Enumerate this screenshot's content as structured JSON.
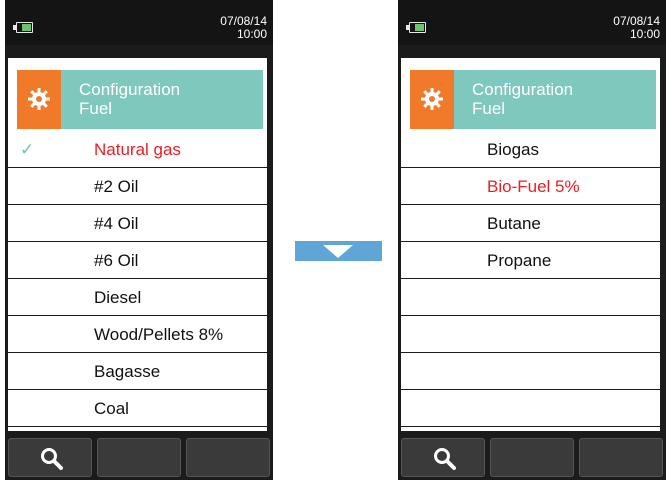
{
  "status": {
    "date": "07/08/14",
    "time": "10:00"
  },
  "header": {
    "title": "Configuration",
    "subtitle": "Fuel"
  },
  "left_screen": {
    "items": [
      {
        "label": "Natural gas",
        "selected": true
      },
      {
        "label": "#2 Oil"
      },
      {
        "label": "#4 Oil"
      },
      {
        "label": "#6 Oil"
      },
      {
        "label": "Diesel"
      },
      {
        "label": "Wood/Pellets 8%"
      },
      {
        "label": "Bagasse"
      },
      {
        "label": "Coal"
      }
    ]
  },
  "right_screen": {
    "items": [
      {
        "label": "Biogas"
      },
      {
        "label": "Bio-Fuel 5%",
        "selected": true
      },
      {
        "label": "Butane"
      },
      {
        "label": "Propane"
      },
      {
        "label": ""
      },
      {
        "label": ""
      },
      {
        "label": ""
      },
      {
        "label": ""
      }
    ]
  },
  "icons": {
    "gear": "gear-icon",
    "search": "search-icon",
    "arrow": "arrow-down-icon",
    "battery": "battery-icon",
    "check": "checkmark-icon"
  },
  "colors": {
    "header": "#7ec8bd",
    "gear_box": "#f07a2a",
    "selected_text": "#ee1c24",
    "arrow": "#5fa6d6"
  }
}
